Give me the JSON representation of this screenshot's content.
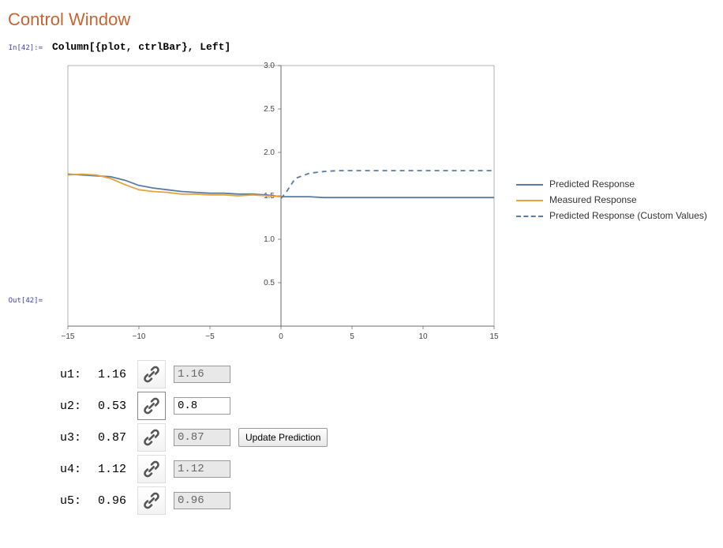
{
  "section_title": "Control Window",
  "in_label": "In[42]:=",
  "out_label": "Out[42]=",
  "code": "Column[{plot, ctrlBar}, Left]",
  "legend": {
    "predicted": "Predicted Response",
    "measured": "Measured Response",
    "custom": "Predicted Response (Custom Values)"
  },
  "controls": [
    {
      "name": "u1",
      "label": "u1:",
      "value": "1.16",
      "input": "1.16",
      "enabled": false
    },
    {
      "name": "u2",
      "label": "u2:",
      "value": "0.53",
      "input": "0.8",
      "enabled": true
    },
    {
      "name": "u3",
      "label": "u3:",
      "value": "0.87",
      "input": "0.87",
      "enabled": false
    },
    {
      "name": "u4",
      "label": "u4:",
      "value": "1.12",
      "input": "1.12",
      "enabled": false
    },
    {
      "name": "u5",
      "label": "u5:",
      "value": "0.96",
      "input": "0.96",
      "enabled": false
    }
  ],
  "update_button": "Update Prediction",
  "chart_data": {
    "type": "line",
    "xlim": [
      -15,
      15
    ],
    "ylim": [
      0,
      3
    ],
    "x_ticks": [
      -15,
      -10,
      -5,
      0,
      5,
      10,
      15
    ],
    "y_ticks": [
      0.5,
      1.0,
      1.5,
      2.0,
      2.5,
      3.0
    ],
    "series": [
      {
        "name": "Predicted Response",
        "color": "#5a7ca3",
        "dash": false,
        "x": [
          -15,
          -14,
          -13,
          -12,
          -11,
          -10,
          -9,
          -8,
          -7,
          -6,
          -5,
          -4,
          -3,
          -2,
          -1,
          0,
          1,
          2,
          3,
          4,
          5,
          6,
          7,
          8,
          9,
          10,
          11,
          12,
          13,
          14,
          15
        ],
        "y": [
          1.75,
          1.74,
          1.73,
          1.72,
          1.68,
          1.62,
          1.59,
          1.57,
          1.55,
          1.54,
          1.53,
          1.53,
          1.52,
          1.52,
          1.51,
          1.49,
          1.49,
          1.49,
          1.48,
          1.48,
          1.48,
          1.48,
          1.48,
          1.48,
          1.48,
          1.48,
          1.48,
          1.48,
          1.48,
          1.48,
          1.48
        ]
      },
      {
        "name": "Measured Response",
        "color": "#e8a33d",
        "dash": false,
        "x": [
          -15,
          -14,
          -13,
          -12,
          -11,
          -10,
          -9,
          -8,
          -7,
          -6,
          -5,
          -4,
          -3,
          -2,
          -1,
          0
        ],
        "y": [
          1.74,
          1.75,
          1.74,
          1.7,
          1.63,
          1.57,
          1.55,
          1.54,
          1.52,
          1.52,
          1.51,
          1.51,
          1.5,
          1.51,
          1.5,
          1.49
        ]
      },
      {
        "name": "Predicted Response (Custom Values)",
        "color": "#5a7ca3",
        "dash": true,
        "x": [
          0,
          0.4,
          1,
          2,
          3,
          4,
          5,
          6,
          7,
          8,
          9,
          10,
          11,
          12,
          13,
          14,
          15
        ],
        "y": [
          1.47,
          1.55,
          1.7,
          1.76,
          1.78,
          1.79,
          1.79,
          1.79,
          1.79,
          1.79,
          1.79,
          1.79,
          1.79,
          1.79,
          1.79,
          1.79,
          1.79
        ]
      }
    ]
  }
}
